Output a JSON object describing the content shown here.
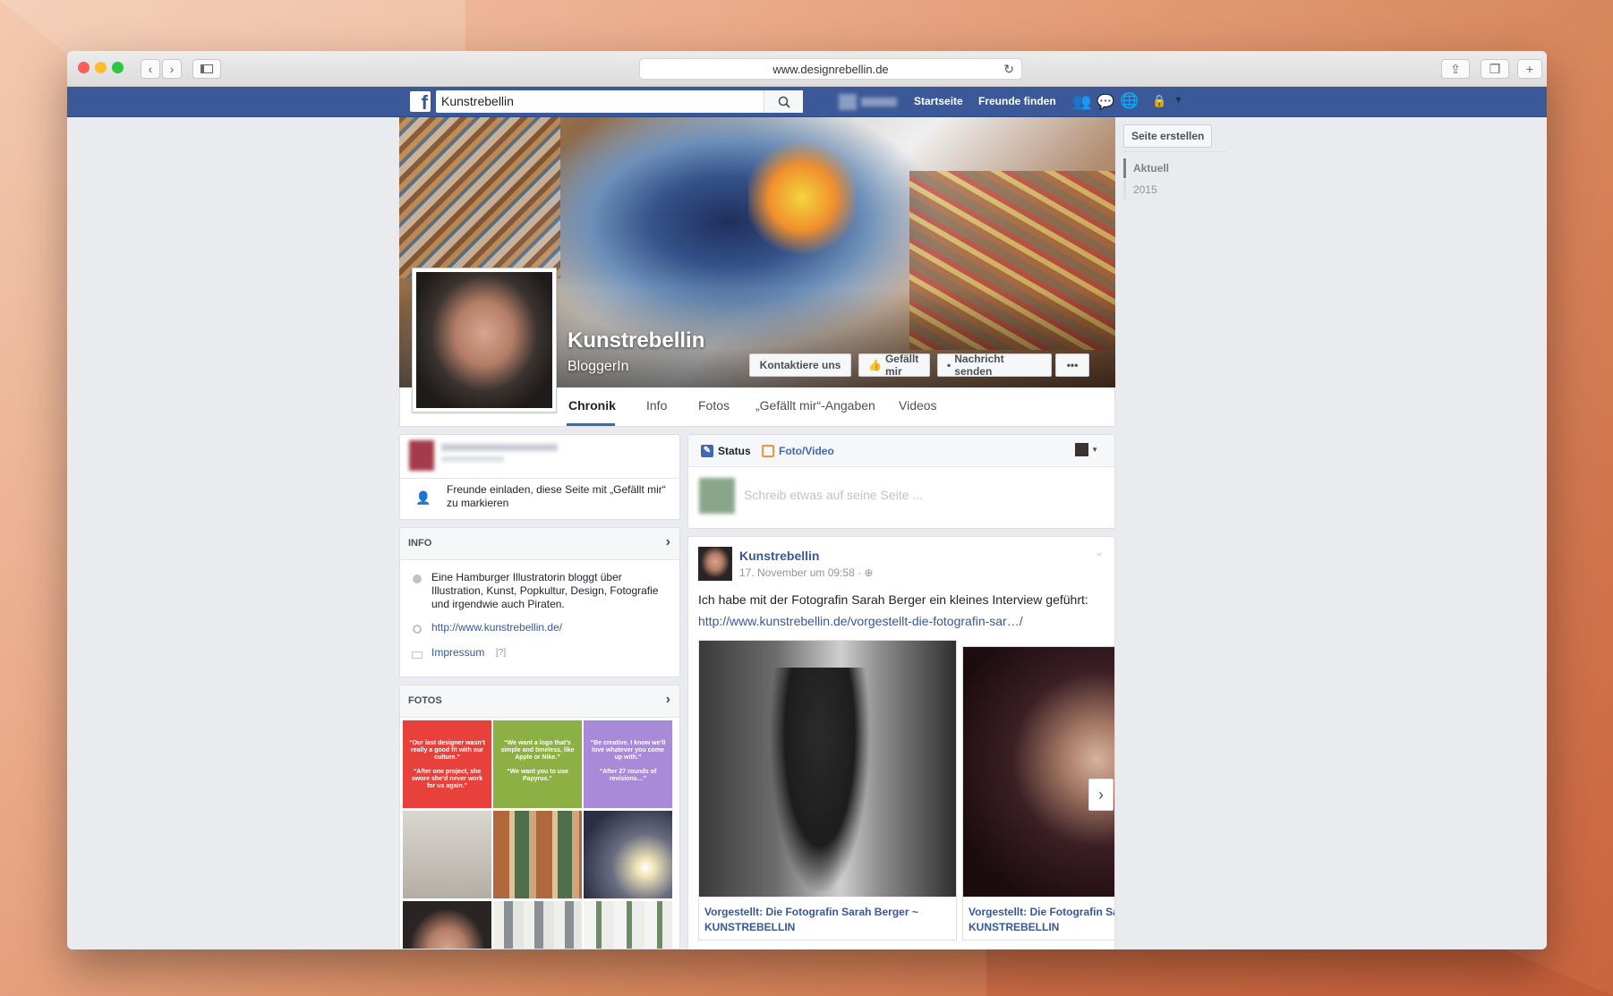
{
  "browser": {
    "url": "www.designrebellin.de"
  },
  "fb_header": {
    "search_value": "Kunstrebellin",
    "nav_home": "Startseite",
    "nav_find_friends": "Freunde finden"
  },
  "page": {
    "name": "Kunstrebellin",
    "category": "BloggerIn",
    "buttons": {
      "contact": "Kontaktiere uns",
      "like": "Gefällt mir",
      "message": "Nachricht senden",
      "more": "•••"
    },
    "tabs": [
      "Chronik",
      "Info",
      "Fotos",
      "„Gefällt mir“-Angaben",
      "Videos"
    ]
  },
  "right_rail": {
    "create_page": "Seite erstellen",
    "timeline": [
      "Aktuell",
      "2015"
    ]
  },
  "invite": {
    "text": "Freunde einladen, diese Seite mit „Gefällt mir“ zu markieren"
  },
  "info_card": {
    "title": "INFO",
    "description": "Eine Hamburger Illustratorin bloggt über Illustration, Kunst, Popkultur, Design, Fotografie und irgendwie auch Piraten.",
    "website": "http://www.kunstrebellin.de/",
    "impressum": "Impressum",
    "impressum_hint": "[?]"
  },
  "photos_card": {
    "title": "FOTOS",
    "tiles": [
      {
        "color": "#e8413c",
        "quote": "“Our last designer wasn’t really a good fit with our culture.”",
        "response": "“After one project, she swore she’d never work for us again.”"
      },
      {
        "color": "#8cb043",
        "quote": "“We want a logo that’s simple and timeless, like Apple or Nike.”",
        "response": "“We want you to use Papyrus.”"
      },
      {
        "color": "#a98ad9",
        "quote": "“Be creative. I know we’ll love whatever you come up with.”",
        "response": "“After 27 rounds of revisions…”"
      }
    ]
  },
  "composer": {
    "status": "Status",
    "photo_video": "Foto/Video",
    "placeholder": "Schreib etwas auf seine Seite ..."
  },
  "post": {
    "author": "Kunstrebellin",
    "time": "17. November um 09:58 · ",
    "text": "Ich habe mit der Fotografin Sarah Berger ein kleines Interview geführt:",
    "link": "http://www.kunstrebellin.de/vorgestellt-die-fotografin-sar…/",
    "attachments": [
      {
        "title": "Vorgestellt: Die Fotografin Sarah Berger ~",
        "source": "KUNSTREBELLIN"
      },
      {
        "title": "Vorgestellt: Die Fotografin Sa",
        "source": "KUNSTREBELLIN"
      }
    ]
  }
}
